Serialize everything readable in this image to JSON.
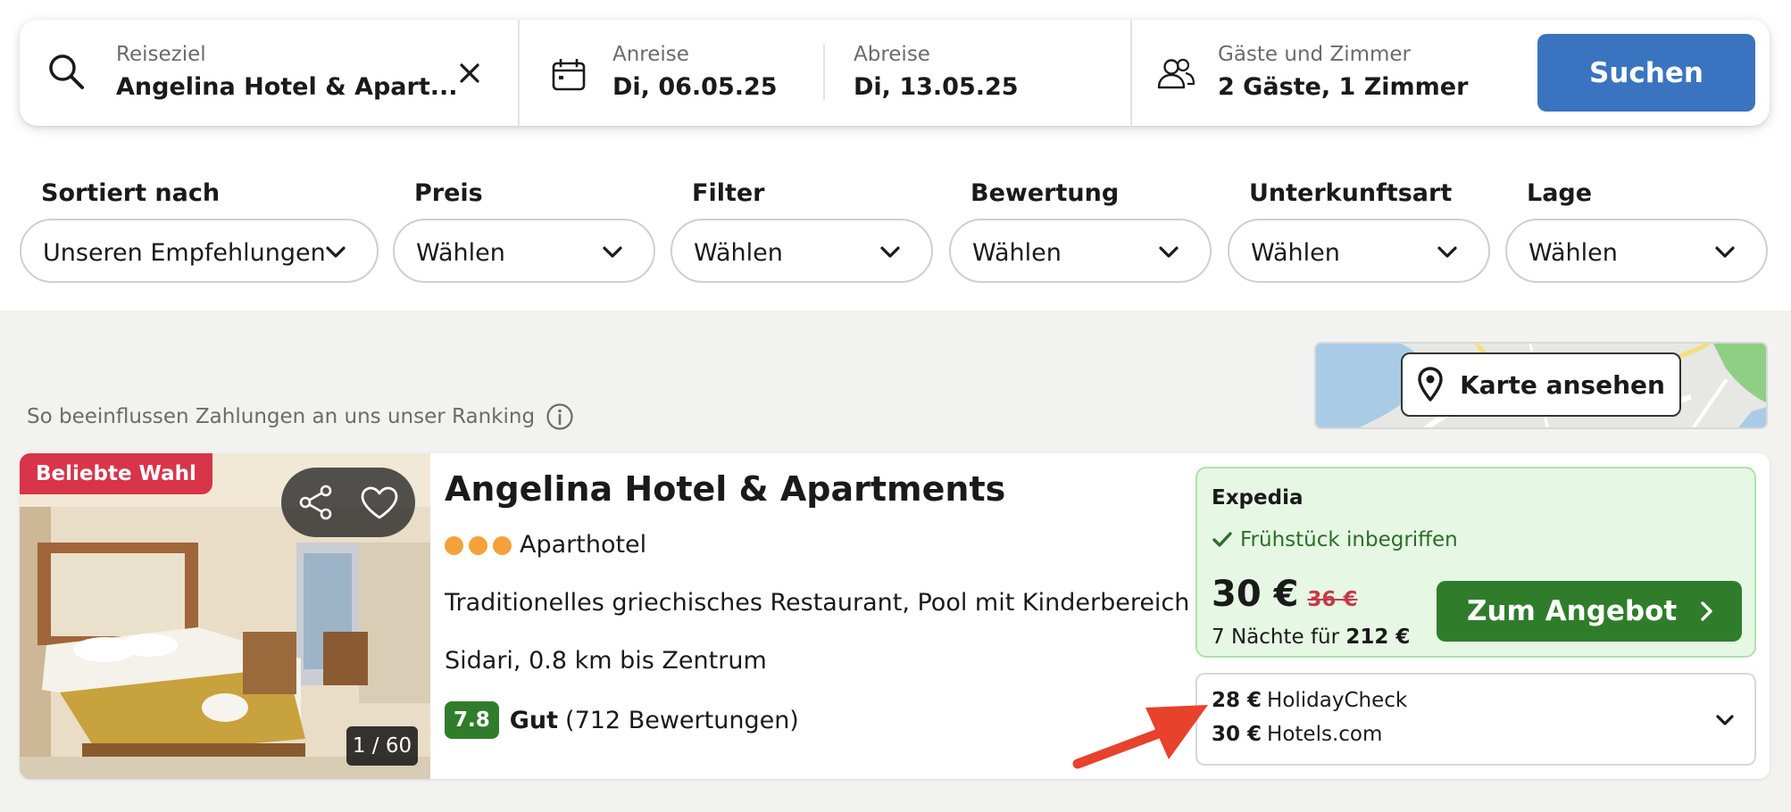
{
  "search": {
    "destination_label": "Reiseziel",
    "destination_value": "Angelina Hotel & Apart...",
    "checkin_label": "Anreise",
    "checkin_value": "Di, 06.05.25",
    "checkout_label": "Abreise",
    "checkout_value": "Di, 13.05.25",
    "guests_label": "Gäste und Zimmer",
    "guests_value": "2 Gäste, 1 Zimmer",
    "search_button": "Suchen"
  },
  "filters": [
    {
      "label": "Sortiert nach",
      "value": "Unseren Empfehlungen"
    },
    {
      "label": "Preis",
      "value": "Wählen"
    },
    {
      "label": "Filter",
      "value": "Wählen"
    },
    {
      "label": "Bewertung",
      "value": "Wählen"
    },
    {
      "label": "Unterkunftsart",
      "value": "Wählen"
    },
    {
      "label": "Lage",
      "value": "Wählen"
    }
  ],
  "ranking_note": "So beeinflussen Zahlungen an uns unser Ranking",
  "map": {
    "button_label": "Karte ansehen"
  },
  "hotel": {
    "badge": "Beliebte Wahl",
    "photo_counter": "1 / 60",
    "name": "Angelina Hotel & Apartments",
    "star_count": 3,
    "type": "Aparthotel",
    "description": "Traditionelles griechisches Restaurant, Pool mit Kinderbereich",
    "location": "Sidari, 0.8 km bis Zentrum",
    "rating_score": "7.8",
    "rating_word": "Gut",
    "rating_count": "(712 Bewertungen)"
  },
  "offer": {
    "provider": "Expedia",
    "feature": "Frühstück inbegriffen",
    "price": "30 €",
    "old_price": "36 €",
    "total_prefix": "7 Nächte für",
    "total_value": "212 €",
    "button_label": "Zum Angebot"
  },
  "other_offers": [
    {
      "price": "28 €",
      "provider": "HolidayCheck"
    },
    {
      "price": "30 €",
      "provider": "Hotels.com"
    }
  ],
  "colors": {
    "search_button": "#3a74c0",
    "deal_button": "#2f7d2b",
    "offer_background": "#e6f7e4",
    "badge_red": "#d8344a",
    "star_orange": "#f5a13a",
    "annotation_arrow": "#e8412c"
  },
  "icons": {
    "search": "search-icon",
    "clear": "close-icon",
    "calendar": "calendar-icon",
    "guests": "users-icon",
    "chevron": "chevron-down-icon",
    "info": "info-icon",
    "pin": "map-pin-icon",
    "share": "share-icon",
    "favorite": "heart-icon",
    "check": "check-icon",
    "next": "chevron-right-icon"
  }
}
